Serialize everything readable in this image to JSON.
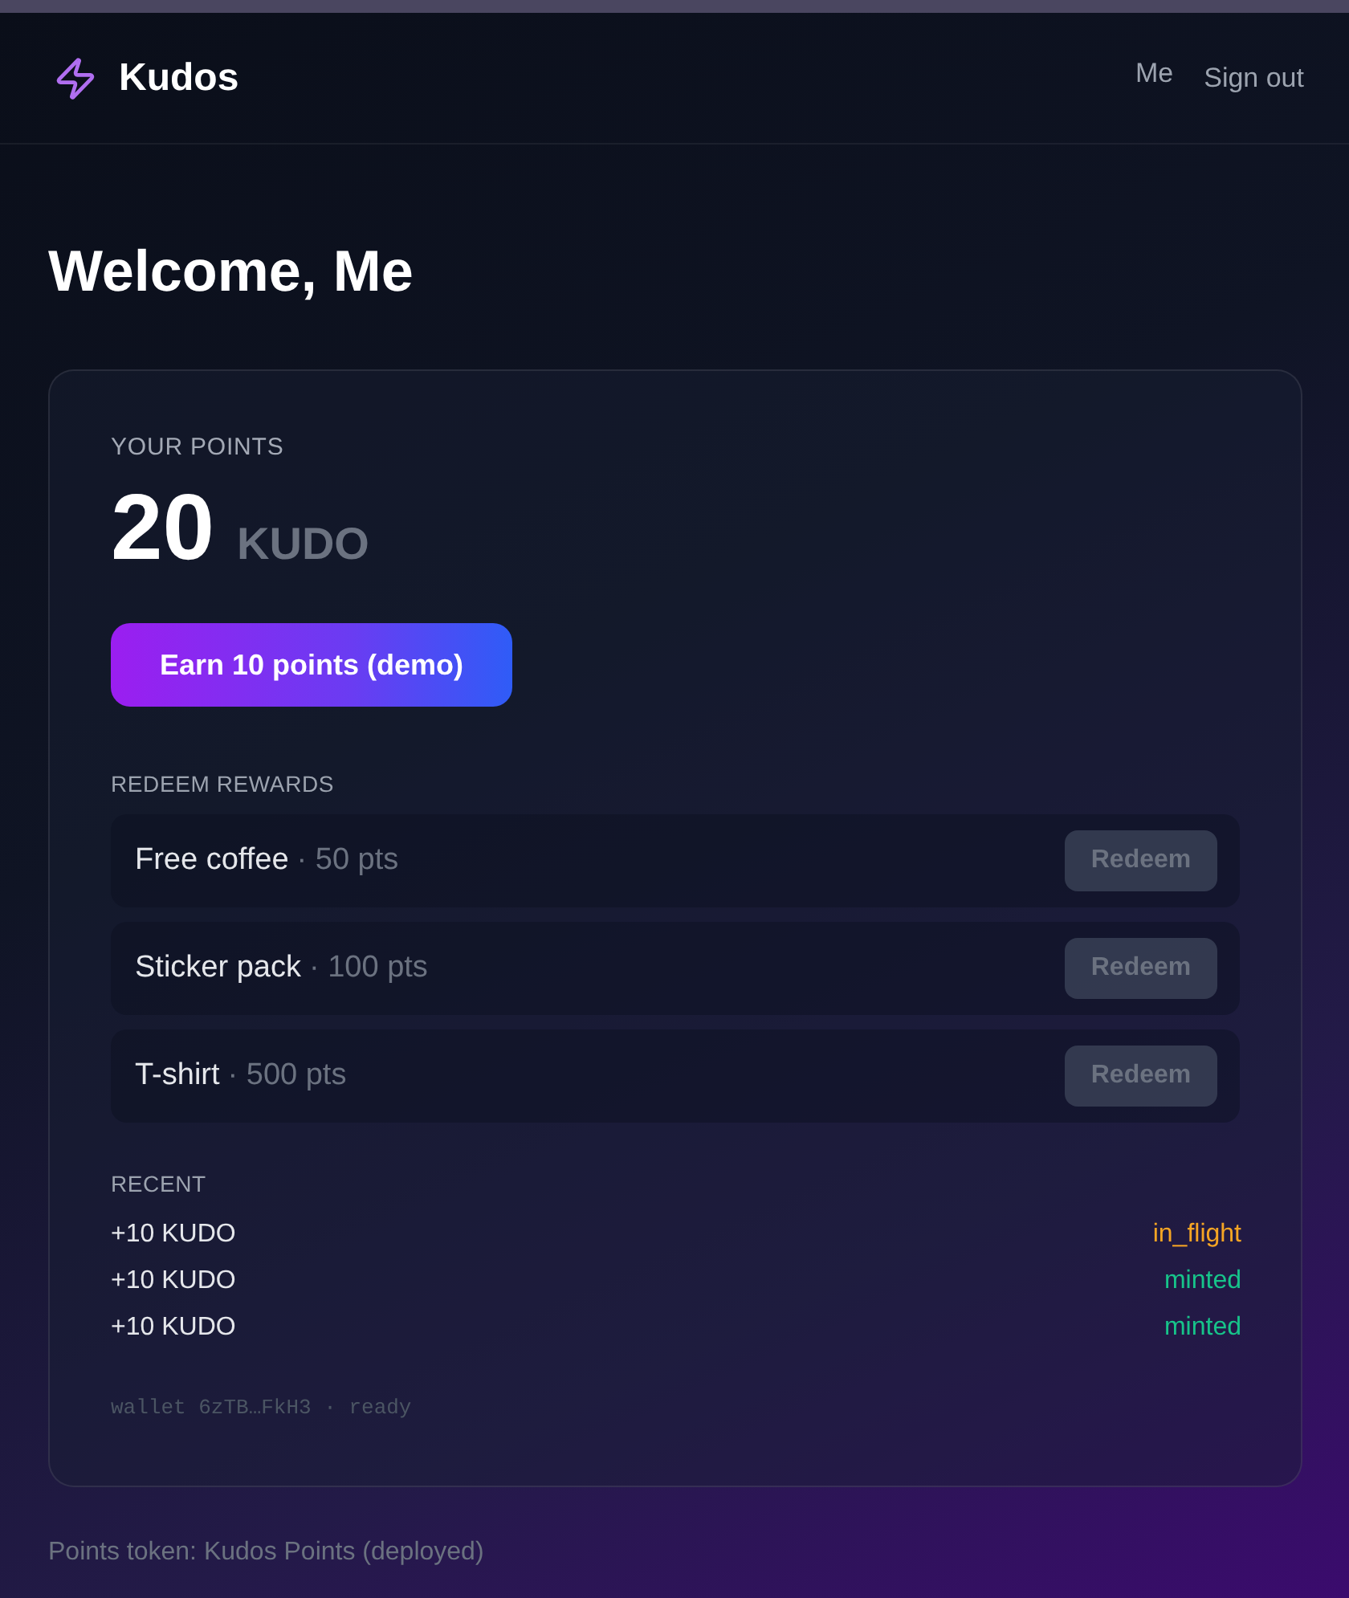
{
  "header": {
    "brand": "Kudos",
    "links": [
      {
        "kind": "user",
        "label": "Me"
      },
      {
        "kind": "signout",
        "label": "Sign out"
      }
    ]
  },
  "title": "Welcome, Me",
  "points": {
    "label": "YOUR POINTS",
    "value": "20",
    "unit": "KUDO",
    "earn_button": "Earn 10 points (demo)"
  },
  "rewards": {
    "heading": "REDEEM REWARDS",
    "items": [
      {
        "name": "Free coffee",
        "cost": "· 50 pts",
        "button": "Redeem",
        "disabled": true
      },
      {
        "name": "Sticker pack",
        "cost": "· 100 pts",
        "button": "Redeem",
        "disabled": true
      },
      {
        "name": "T-shirt",
        "cost": "· 500 pts",
        "button": "Redeem",
        "disabled": true
      }
    ]
  },
  "recent": {
    "heading": "RECENT",
    "items": [
      {
        "amount": "+10 KUDO",
        "status": "in_flight",
        "color": "#f5a524"
      },
      {
        "amount": "+10 KUDO",
        "status": "minted",
        "color": "#17c48a"
      },
      {
        "amount": "+10 KUDO",
        "status": "minted",
        "color": "#17c48a"
      }
    ]
  },
  "wallet": "wallet 6zTB…FkH3 · ready",
  "footer": "Points token: Kudos Points (deployed)"
}
